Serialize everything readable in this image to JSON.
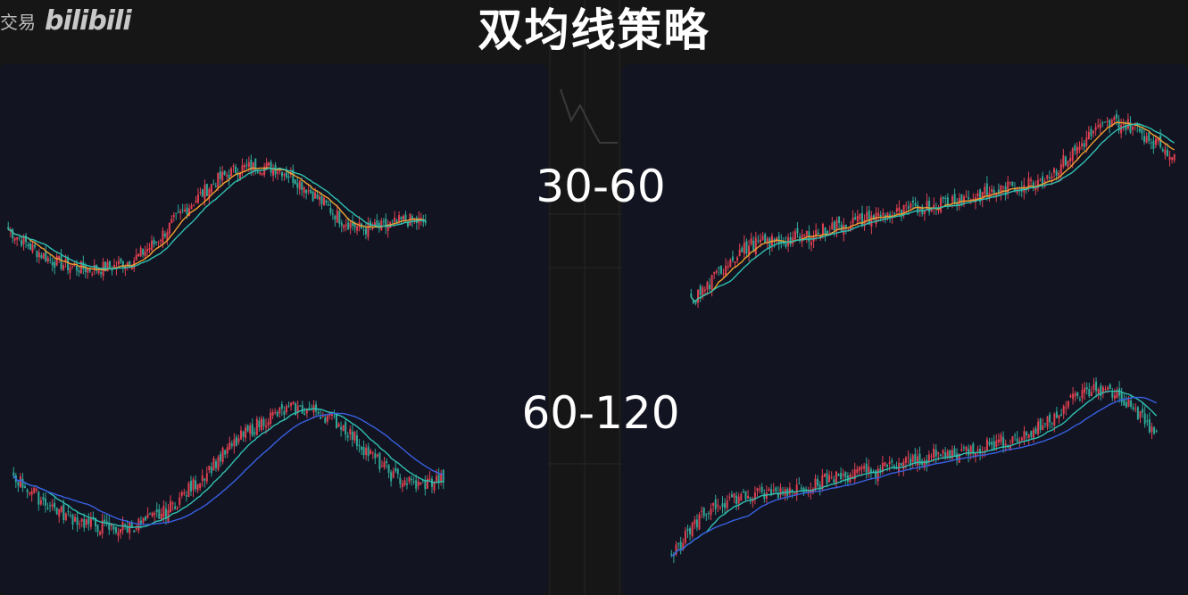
{
  "title": "双均线策略",
  "watermark": {
    "text": "交易",
    "logo": "bilibili"
  },
  "labels": [
    "30-60",
    "60-120"
  ],
  "colors": {
    "up": "#e04050",
    "down": "#2fa897",
    "ma_fast_top": "#f0a030",
    "ma_slow_top": "#30c0b0",
    "ma_fast_bottom": "#30c0b0",
    "ma_slow_bottom": "#3860e0",
    "panel_bg": "#121422"
  },
  "chart_data": [
    {
      "type": "candlestick",
      "panel": "left",
      "strategy": "30-60",
      "grid": false,
      "price_path": [
        40,
        33,
        27,
        24,
        23,
        24,
        27,
        34,
        44,
        53,
        61,
        66,
        67,
        66,
        60,
        52,
        44,
        40,
        41,
        44,
        43
      ],
      "ma_periods": [
        30,
        60
      ]
    },
    {
      "type": "candlestick",
      "panel": "left",
      "strategy": "60-120",
      "grid": false,
      "price_path": [
        42,
        33,
        26,
        22,
        20,
        22,
        27,
        37,
        48,
        58,
        66,
        70,
        69,
        63,
        52,
        42,
        38,
        41
      ],
      "ma_periods": [
        60,
        120
      ]
    },
    {
      "type": "candlestick",
      "panel": "right",
      "strategy": "30-60",
      "grid": false,
      "price_path": [
        10,
        18,
        28,
        33,
        34,
        35,
        37,
        40,
        42,
        44,
        45,
        47,
        49,
        51,
        52,
        54,
        56,
        58,
        62,
        70,
        78,
        82,
        80,
        74,
        69
      ],
      "ma_periods": [
        30,
        60
      ]
    },
    {
      "type": "candlestick",
      "panel": "right",
      "strategy": "60-120",
      "grid": false,
      "price_path": [
        10,
        20,
        30,
        33,
        34,
        35,
        37,
        39,
        41,
        43,
        44,
        46,
        48,
        50,
        51,
        53,
        55,
        57,
        60,
        67,
        74,
        77,
        75,
        68,
        58
      ],
      "ma_periods": [
        60,
        120
      ]
    }
  ]
}
